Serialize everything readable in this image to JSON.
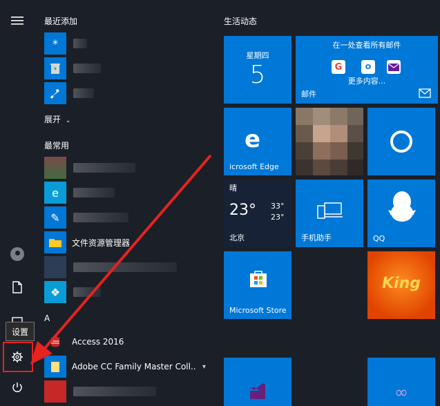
{
  "rail": {
    "menu_icon": "hamburger-icon",
    "user_icon": "user-icon",
    "doc_icon": "document-icon",
    "settings_icon": "gear-icon",
    "power_icon": "power-icon",
    "settings_tooltip": "设置"
  },
  "app_list": {
    "recent_header": "最近添加",
    "expand_label": "展开",
    "frequent_header": "最常用",
    "explorer_label": "文件资源管理器",
    "letter_a": "A",
    "access_label": "Access 2016",
    "adobe_label": "Adobe CC Family Master Coll..."
  },
  "tiles": {
    "header": "生活动态",
    "calendar_day": "星期四",
    "calendar_date": "5",
    "mail_title": "在一处查看所有邮件",
    "mail_more": "更多内容...",
    "mail_label": "邮件",
    "edge_label": "icrosoft Edge",
    "weather_condition": "晴",
    "weather_temp": "23°",
    "weather_high": "33°",
    "weather_low": "23°",
    "weather_city": "北京",
    "phone_label": "手机助手",
    "qq_label": "QQ",
    "store_label": "Microsoft Store",
    "king_label": "King"
  },
  "colors": {
    "tile_blue": "#0078d7",
    "highlight_red": "#e5231f",
    "king_orange": "#ff6a00"
  }
}
